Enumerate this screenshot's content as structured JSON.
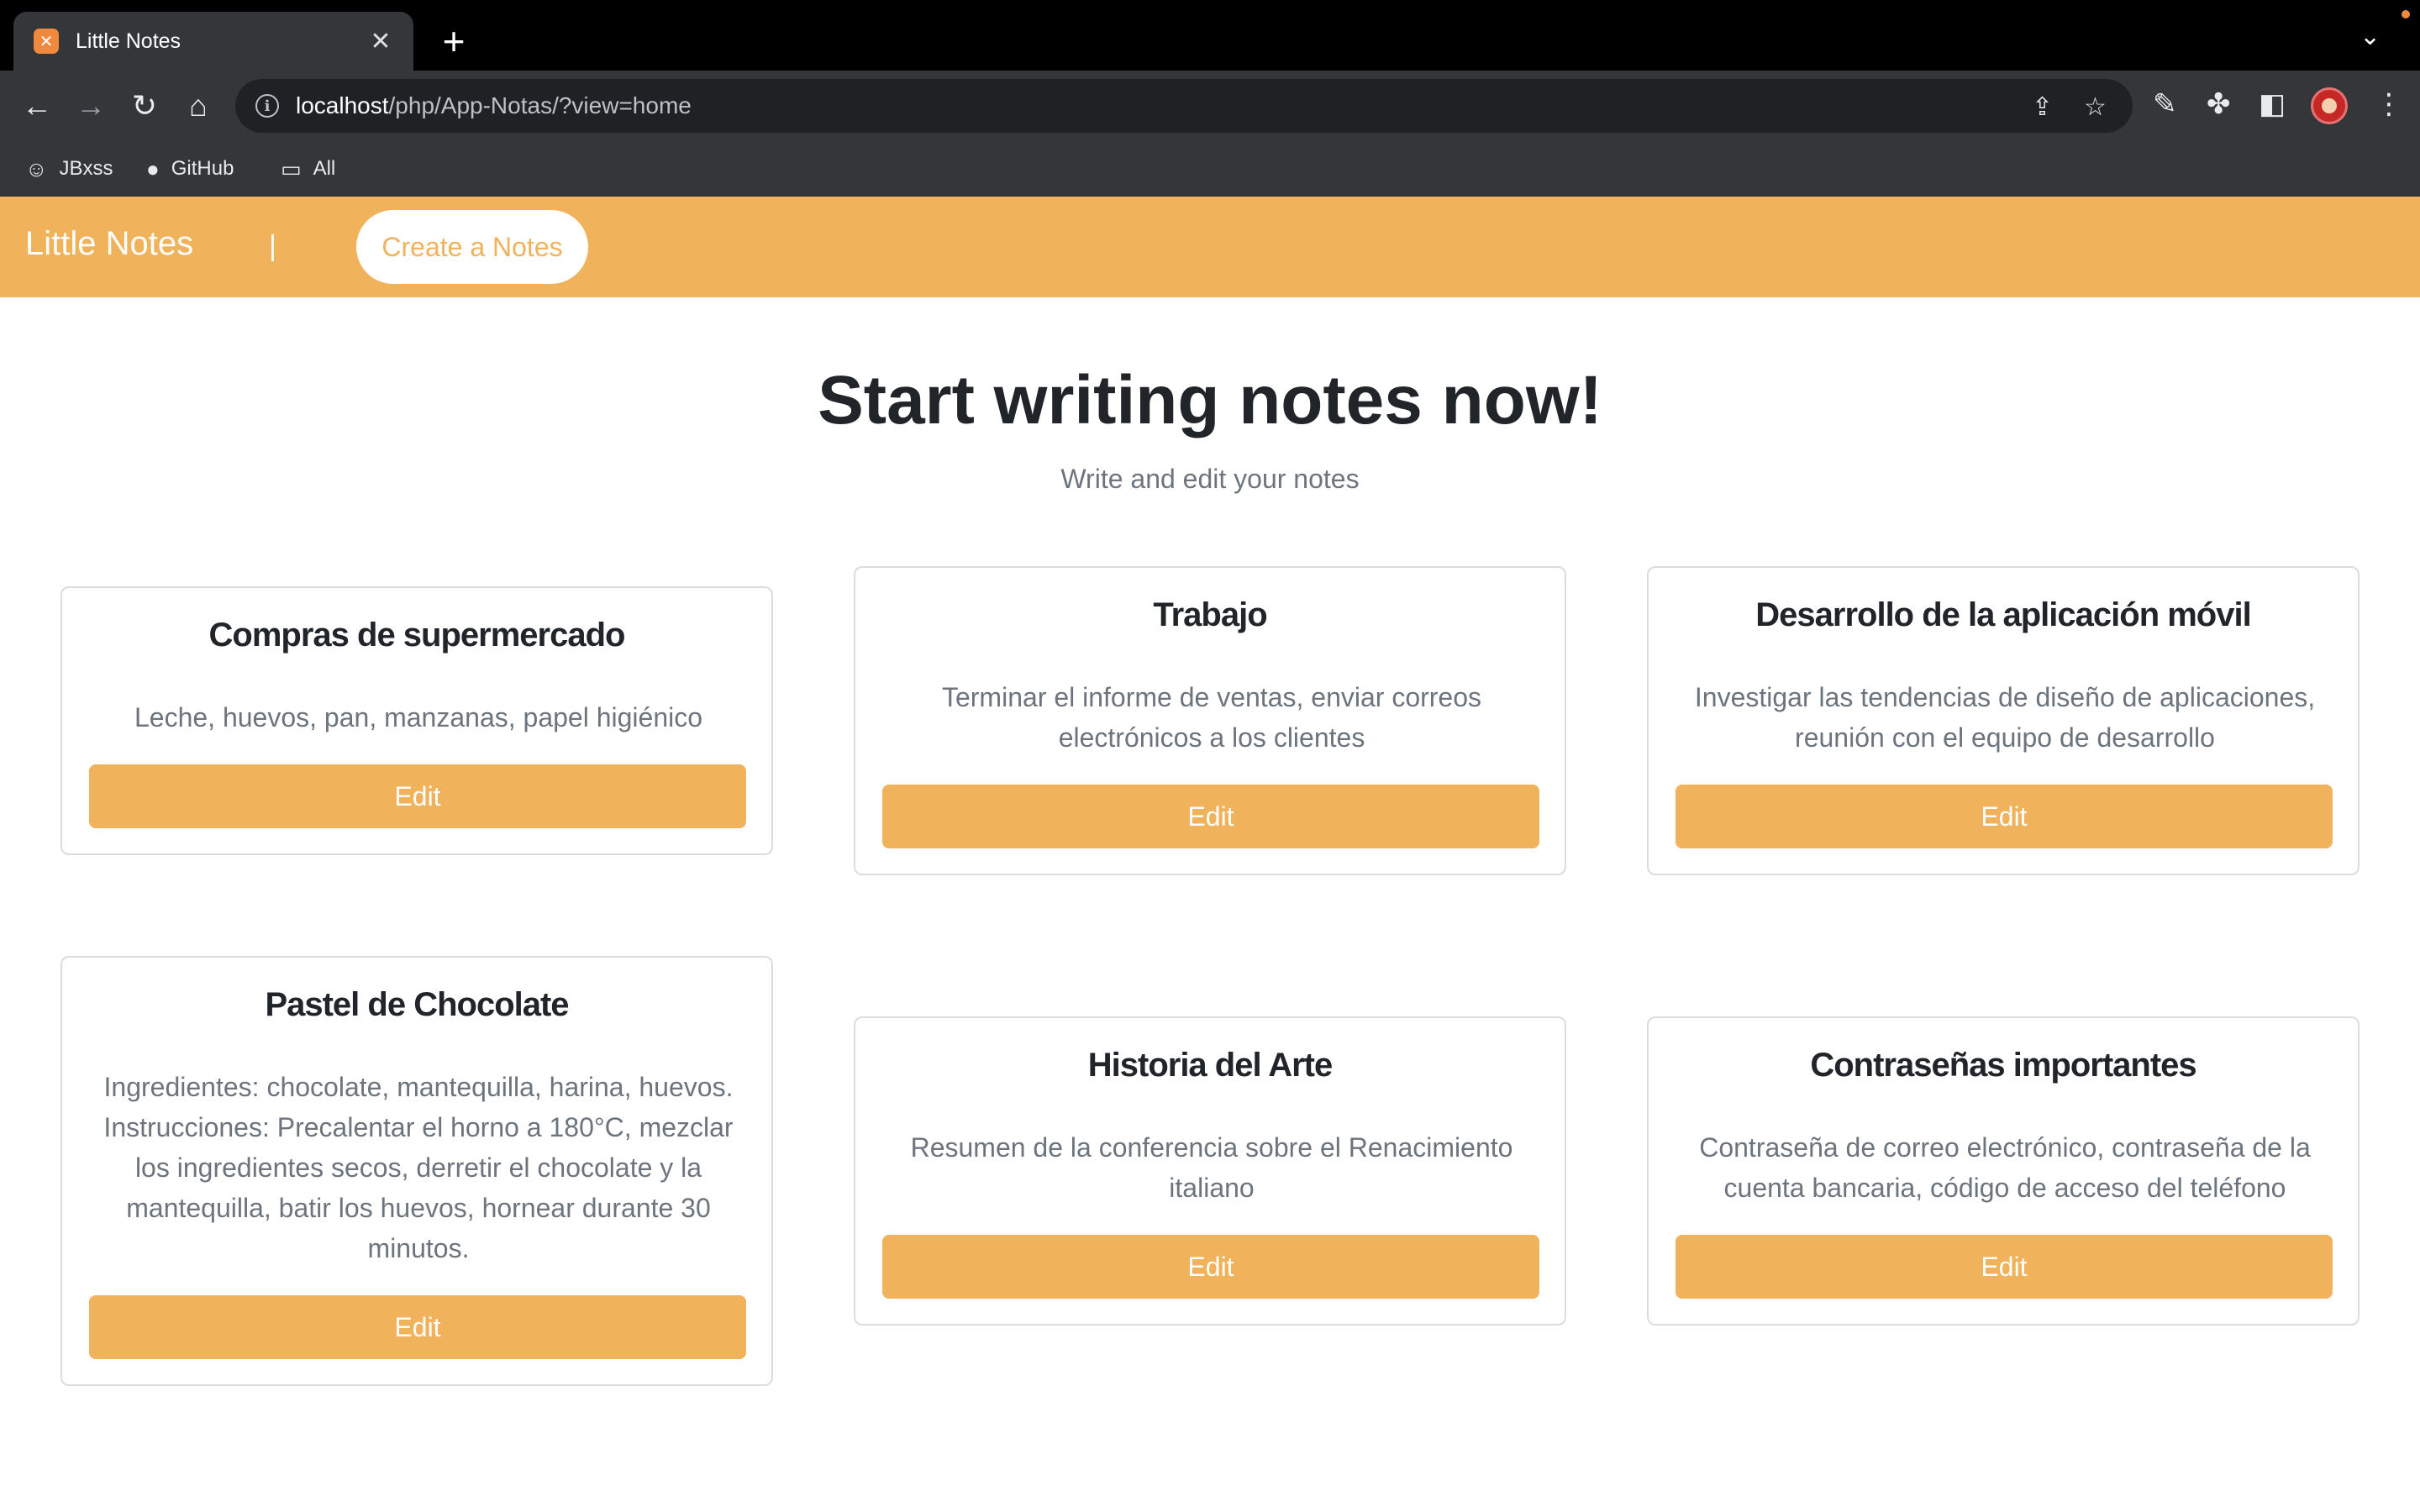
{
  "browser": {
    "tab_title": "Little Notes",
    "tab_favicon": "xampp-icon",
    "url_host": "localhost",
    "url_path": "/php/App-Notas/?view=home",
    "bookmarks": [
      {
        "label": "JBxss",
        "icon": "user-avatar-icon"
      },
      {
        "label": "GitHub",
        "icon": "github-icon"
      },
      {
        "label": "All",
        "icon": "folder-icon"
      }
    ]
  },
  "navbar": {
    "brand": "Little Notes",
    "separator": "|",
    "create_label": "Create a Notes",
    "color": "#f0b25a"
  },
  "hero": {
    "title": "Start writing notes now!",
    "subtitle": "Write and edit your notes"
  },
  "notes": [
    {
      "title": "Compras de supermercado",
      "text": "Leche, huevos, pan, manzanas, papel higiénico",
      "button": "Edit"
    },
    {
      "title": "Trabajo",
      "text": "Terminar el informe de ventas, enviar correos electrónicos a los clientes",
      "button": "Edit"
    },
    {
      "title": "Desarrollo de la aplicación móvil",
      "text": "Investigar las tendencias de diseño de aplicaciones, reunión con el equipo de desarrollo",
      "button": "Edit"
    },
    {
      "title": "Pastel de Chocolate",
      "text": "Ingredientes: chocolate, mantequilla, harina, huevos. Instrucciones: Precalentar el horno a 180°C, mezclar los ingredientes secos, derretir el chocolate y la mantequilla, batir los huevos, hornear durante 30 minutos.",
      "button": "Edit"
    },
    {
      "title": "Historia del Arte",
      "text": "Resumen de la conferencia sobre el Renacimiento italiano",
      "button": "Edit"
    },
    {
      "title": "Contraseñas importantes",
      "text": "Contraseña de correo electrónico, contraseña de la cuenta bancaria, código de acceso del teléfono",
      "button": "Edit"
    }
  ]
}
